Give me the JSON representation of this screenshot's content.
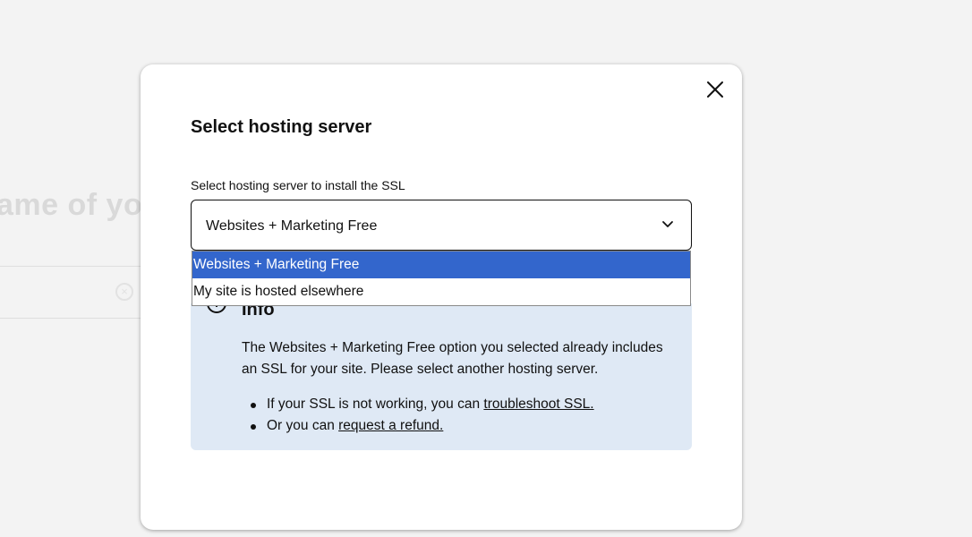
{
  "background": {
    "heading_fragment": "ame of yo",
    "clear_icon": "clear-circle-icon"
  },
  "modal": {
    "close_icon": "close-icon",
    "title": "Select hosting server",
    "field_label": "Select hosting server to install the SSL",
    "select": {
      "value": "Websites + Marketing Free",
      "icon": "chevron-down-icon",
      "options": [
        {
          "label": "Websites + Marketing Free",
          "selected": true
        },
        {
          "label": "My site is hosted elsewhere",
          "selected": false
        }
      ]
    },
    "info": {
      "icon": "info-icon",
      "title": "Info",
      "body": "The Websites + Marketing Free option you selected already includes an SSL for your site. Please select another hosting server.",
      "items": [
        {
          "text": "If your SSL is not working, you can ",
          "link": "troubleshoot SSL."
        },
        {
          "text": "Or you can ",
          "link": "request a refund."
        }
      ]
    }
  },
  "colors": {
    "highlight": "#3366cc",
    "info_bg": "#dfe9f5",
    "page_bg": "#f3f3f3"
  }
}
